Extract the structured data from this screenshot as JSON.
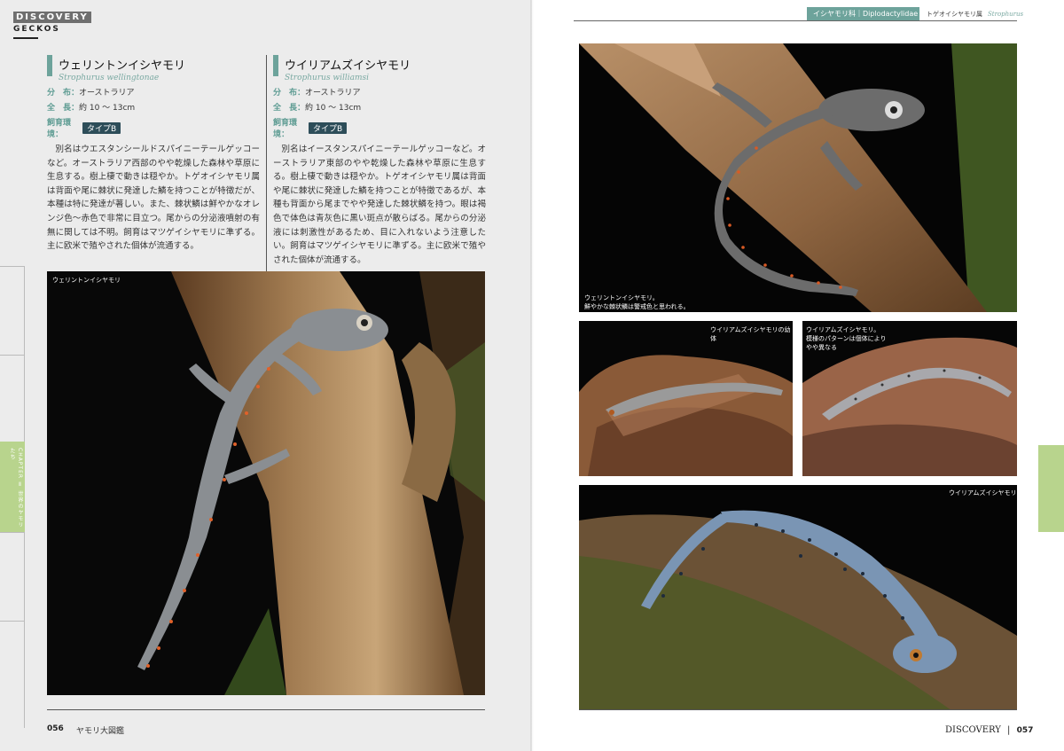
{
  "header": {
    "section": "DISCOVERY",
    "sub": "GECKOS"
  },
  "side_tab": {
    "label": "CHAPTER Ⅱ 世界のヤモリたち"
  },
  "species": [
    {
      "name_jp": "ウェリントンイシヤモリ",
      "name_sci": "Strophurus wellingtonae",
      "dist_label": "分　布：",
      "dist": "オーストラリア",
      "length_label": "全　長：",
      "length": "約 10 〜 13cm",
      "env_label": "飼育環境：",
      "env_type": "タイプB",
      "text": "別名はウエスタンシールドスパイニーテールゲッコーなど。オーストラリア西部のやや乾燥した森林や草原に生息する。樹上棲で動きは穏やか。トゲオイシヤモリ属は背面や尾に棘状に発達した鱗を持つことが特徴だが、本種は特に発達が著しい。また、棘状鱗は鮮やかなオレンジ色〜赤色で非常に目立つ。尾からの分泌液噴射の有無に関しては不明。飼育はマツゲイシヤモリに準ずる。主に欧米で殖やされた個体が流通する。"
    },
    {
      "name_jp": "ウイリアムズイシヤモリ",
      "name_sci": "Strophurus williamsi",
      "dist_label": "分　布：",
      "dist": "オーストラリア",
      "length_label": "全　長：",
      "length": "約 10 〜 13cm",
      "env_label": "飼育環境：",
      "env_type": "タイプB",
      "text": "別名はイースタンスパイニーテールゲッコーなど。オーストラリア東部のやや乾燥した森林や草原に生息する。樹上棲で動きは穏やか。トゲオイシヤモリ属は背面や尾に棘状に発達した鱗を持つことが特徴であるが、本種も背面から尾までやや発達した棘状鱗を持つ。眼は褐色で体色は青灰色に黒い斑点が散らばる。尾からの分泌液には刺激性があるため、目に入れないよう注意したい。飼育はマツゲイシヤモリに準ずる。主に欧米で殖やされた個体が流通する。"
    }
  ],
  "photos": {
    "main_left": {
      "caption": "ウェリントンイシヤモリ"
    },
    "top_right": {
      "caption_line1": "ウェリントンイシヤモリ。",
      "caption_line2": "鮮やかな棘状鱗は警戒色と思われる。"
    },
    "mid_left": {
      "caption": "ウイリアムズイシヤモリの幼体"
    },
    "mid_right": {
      "caption_line1": "ウイリアムズイシヤモリ。",
      "caption_line2": "模様のパターンは個体により",
      "caption_line3": "やや異なる"
    },
    "bottom": {
      "caption": "ウイリアムズイシヤモリ"
    }
  },
  "right_header": {
    "family": "イシヤモリ科｜Diplodactylidae",
    "genus": "トゲオイシヤモリ属",
    "genus_sci": "Strophurus"
  },
  "footer_left": {
    "page": "056",
    "book": "ヤモリ大図鑑"
  },
  "footer_right": {
    "section": "DISCOVERY",
    "page": "057"
  }
}
